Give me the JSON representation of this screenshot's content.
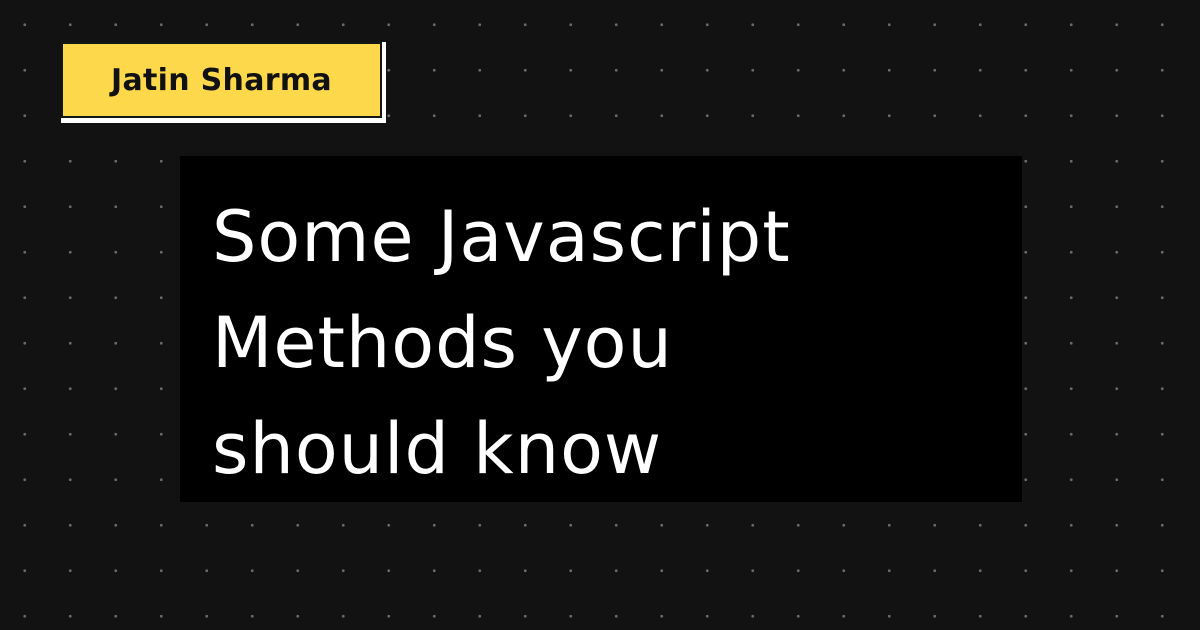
{
  "author": {
    "name": "Jatin Sharma"
  },
  "title": {
    "lines": [
      "Some Javascript",
      "Methods you",
      "should know"
    ]
  },
  "colors": {
    "background": "#121212",
    "dot_grid": "#6a6a6a",
    "badge_fill": "#fcd84a",
    "badge_shadow": "#ffffff",
    "panel": "#000000",
    "title_text": "#ffffff",
    "author_text": "#111111"
  }
}
